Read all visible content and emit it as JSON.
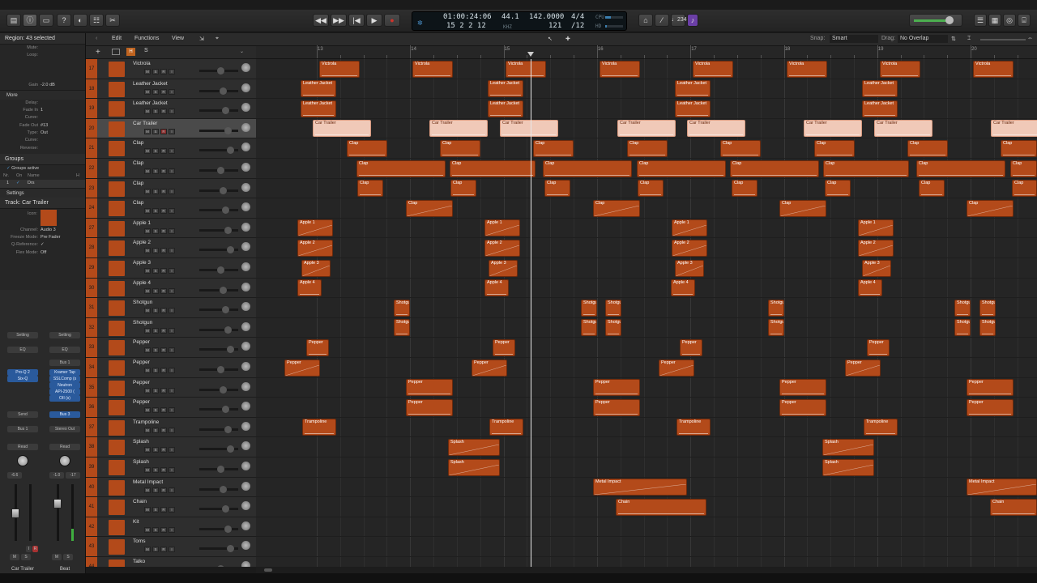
{
  "control_bar": {
    "position": "01:00:24:06",
    "bars": "15  2  2    12",
    "sample_rate": "44.1",
    "sample_rate_sub": "KHZ",
    "tempo": "142.0000",
    "tempo_sub": "121",
    "signature": "4/4",
    "division": "/12",
    "cpu_label": "CPU",
    "hd_label": "HD",
    "count_in": "♩234",
    "colors": {
      "accent": "#b34a1a",
      "record": "#d0342c"
    }
  },
  "toolbar": {
    "edit": "Edit",
    "functions": "Functions",
    "view": "View",
    "snap_label": "Snap:",
    "snap_value": "Smart",
    "drag_label": "Drag:",
    "drag_value": "No Overlap"
  },
  "track_header_bar": {
    "h": "H",
    "s": "S"
  },
  "inspector": {
    "region_title": "Region: 43 selected",
    "region_rows": [
      {
        "k": "Mute:",
        "v": ""
      },
      {
        "k": "Loop:",
        "v": ""
      },
      {
        "k": "",
        "v": ""
      },
      {
        "k": "",
        "v": ""
      },
      {
        "k": "",
        "v": ""
      },
      {
        "k": "Gain",
        "v": "-2.0 dB"
      }
    ],
    "more": "More",
    "more_rows": [
      {
        "k": "Delay:",
        "v": ""
      },
      {
        "k": "Fade In",
        "v": "1"
      },
      {
        "k": "Curve:",
        "v": ""
      },
      {
        "k": "Fade Out",
        "v": "#13"
      },
      {
        "k": "Type:",
        "v": "Out"
      },
      {
        "k": "Curve:",
        "v": ""
      },
      {
        "k": "Reverse:",
        "v": ""
      }
    ],
    "groups_title": "Groups",
    "groups_active": "Groups active",
    "groups_cols": [
      "Nr.",
      "On",
      "Name",
      "H"
    ],
    "group_row": {
      "nr": "1",
      "on": "✓",
      "name": "Drs"
    },
    "settings": "Settings",
    "track_title": "Track:  Car Trailer",
    "track_rows": [
      {
        "k": "Icon:",
        "v": ""
      },
      {
        "k": "Channel:",
        "v": "Audio 3"
      },
      {
        "k": "Freeze Mode:",
        "v": "Pre Fader"
      },
      {
        "k": "Q-Reference:",
        "v": "✓"
      },
      {
        "k": "Flex Mode:",
        "v": "Off"
      }
    ]
  },
  "strips": [
    {
      "name": "Car Trailer",
      "slots": [
        "Setting",
        "EQ",
        "Pro-Q 2",
        "Six-Q",
        "",
        "",
        "Send",
        "Bus 1",
        "",
        "Read"
      ],
      "vol": "-6.6",
      "peak": "",
      "buttons": [
        "M",
        "S"
      ],
      "extra": [
        "I",
        "R"
      ]
    },
    {
      "name": "Beat",
      "slots": [
        "Setting",
        "EQ",
        "Bus 1",
        "Kramer Tap",
        "SSLComp (s",
        "Neutron",
        "API-2500 (",
        "OII (s)",
        "Bus 3",
        "Stereo Out",
        "Read"
      ],
      "vol": "-1.0",
      "peak": "-17",
      "buttons": [
        "M",
        "S"
      ]
    }
  ],
  "ruler": {
    "bars": [
      "13",
      "14",
      "15",
      "16",
      "17",
      "18",
      "19",
      "20"
    ]
  },
  "tracks": [
    {
      "num": "17",
      "name": "Victrola"
    },
    {
      "num": "18",
      "name": "Leather Jacket"
    },
    {
      "num": "19",
      "name": "Leather Jacket"
    },
    {
      "num": "20",
      "name": "Car Trailer",
      "selected": true
    },
    {
      "num": "21",
      "name": "Clap"
    },
    {
      "num": "22",
      "name": "Clap"
    },
    {
      "num": "23",
      "name": "Clap"
    },
    {
      "num": "24",
      "name": "Clap"
    },
    {
      "num": "27",
      "name": "Apple 1"
    },
    {
      "num": "28",
      "name": "Apple 2"
    },
    {
      "num": "29",
      "name": "Apple 3"
    },
    {
      "num": "30",
      "name": "Apple 4"
    },
    {
      "num": "31",
      "name": "Shotgun"
    },
    {
      "num": "32",
      "name": "Shotgun"
    },
    {
      "num": "33",
      "name": "Pepper"
    },
    {
      "num": "34",
      "name": "Pepper"
    },
    {
      "num": "35",
      "name": "Pepper"
    },
    {
      "num": "36",
      "name": "Pepper"
    },
    {
      "num": "37",
      "name": "Trampoline"
    },
    {
      "num": "38",
      "name": "Splash"
    },
    {
      "num": "39",
      "name": "Splash"
    },
    {
      "num": "40",
      "name": "Metal Impact"
    },
    {
      "num": "41",
      "name": "Chain"
    },
    {
      "num": "42",
      "name": "Kit"
    },
    {
      "num": "43",
      "name": "Toms"
    },
    {
      "num": "44",
      "name": "Talko"
    }
  ],
  "track_buttons": [
    "M",
    "S",
    "R",
    "I"
  ]
}
